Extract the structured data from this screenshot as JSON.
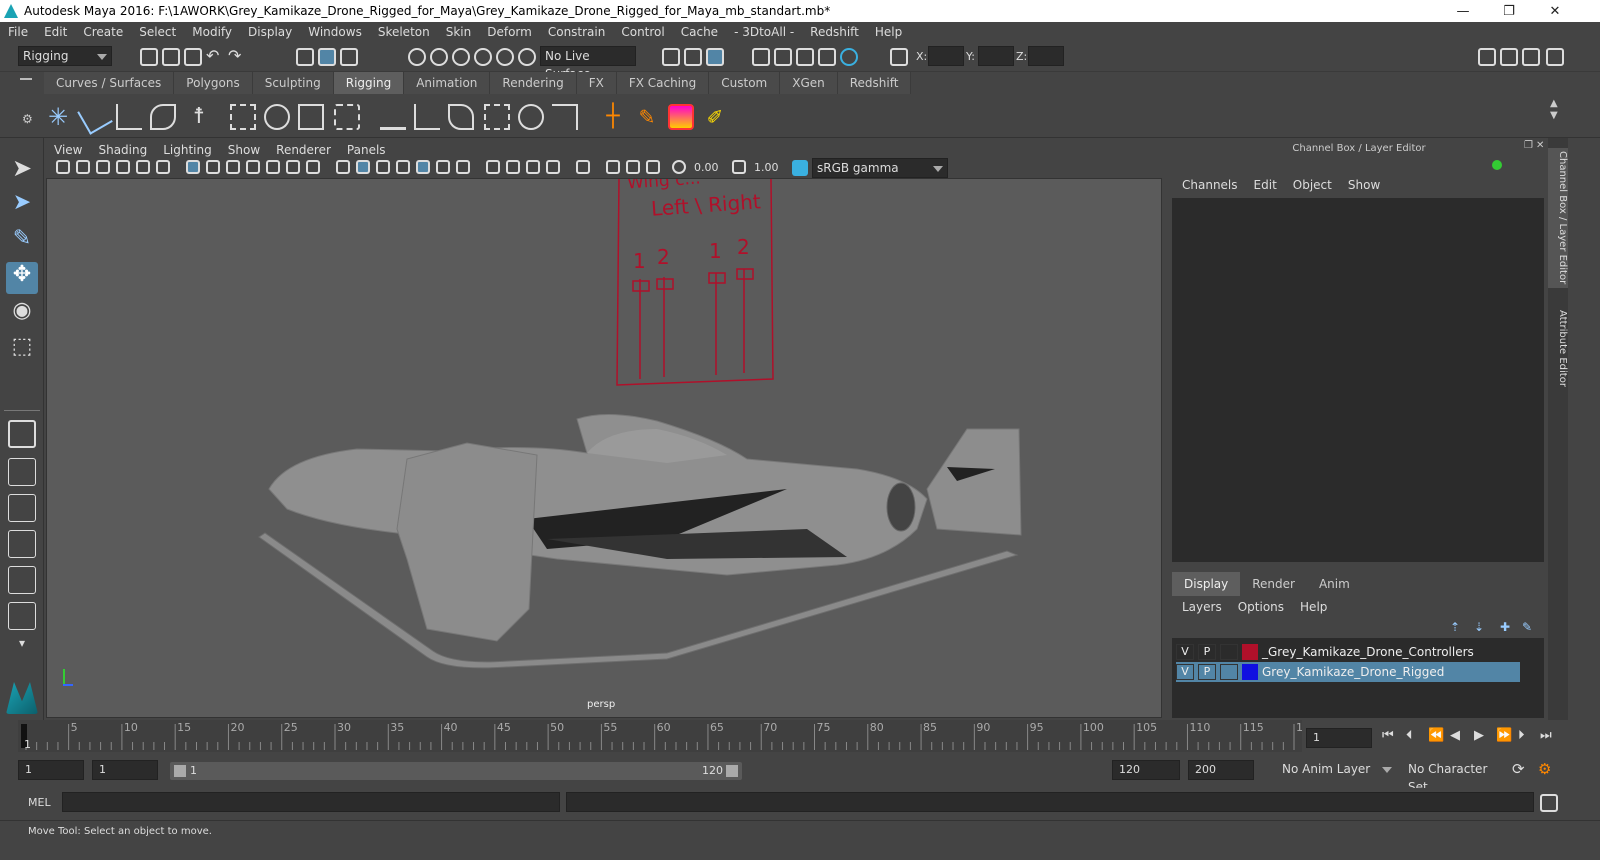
{
  "window": {
    "title": "Autodesk Maya 2016: F:\\1AWORK\\Grey_Kamikaze_Drone_Rigged_for_Maya\\Grey_Kamikaze_Drone_Rigged_for_Maya_mb_standart.mb*",
    "minimize": "—",
    "restore": "❐",
    "close": "✕"
  },
  "menu": [
    "File",
    "Edit",
    "Create",
    "Select",
    "Modify",
    "Display",
    "Windows",
    "Skeleton",
    "Skin",
    "Deform",
    "Constrain",
    "Control",
    "Cache",
    "- 3DtoAll -",
    "Redshift",
    "Help"
  ],
  "statusline": {
    "menuset": "Rigging",
    "live_surface": "No Live Surface",
    "x_label": "X:",
    "y_label": "Y:",
    "z_label": "Z:"
  },
  "shelf_tabs": [
    {
      "label": "Curves / Surfaces",
      "active": false
    },
    {
      "label": "Polygons",
      "active": false
    },
    {
      "label": "Sculpting",
      "active": false
    },
    {
      "label": "Rigging",
      "active": true
    },
    {
      "label": "Animation",
      "active": false
    },
    {
      "label": "Rendering",
      "active": false
    },
    {
      "label": "FX",
      "active": false
    },
    {
      "label": "FX Caching",
      "active": false
    },
    {
      "label": "Custom",
      "active": false
    },
    {
      "label": "XGen",
      "active": false
    },
    {
      "label": "Redshift",
      "active": false
    }
  ],
  "viewport": {
    "menu": [
      "View",
      "Shading",
      "Lighting",
      "Show",
      "Renderer",
      "Panels"
    ],
    "exposure": "0.00",
    "gamma": "1.00",
    "color_space": "sRGB gamma",
    "camera_label": "persp",
    "rig_panel": {
      "title": "Wing c...",
      "subtitle": "Left \\ Right",
      "numbers": [
        "1",
        "2",
        "1",
        "2"
      ]
    }
  },
  "channel_box": {
    "header": "Channel Box / Layer Editor",
    "menu": [
      "Channels",
      "Edit",
      "Object",
      "Show"
    ]
  },
  "layer_editor": {
    "tabs": [
      {
        "label": "Display",
        "active": true
      },
      {
        "label": "Render",
        "active": false
      },
      {
        "label": "Anim",
        "active": false
      }
    ],
    "menu": [
      "Layers",
      "Options",
      "Help"
    ],
    "layers": [
      {
        "v": "V",
        "p": "P",
        "color": "#b0102a",
        "name": "_Grey_Kamikaze_Drone_Controllers",
        "selected": false
      },
      {
        "v": "V",
        "p": "P",
        "color": "#1010e0",
        "name": "Grey_Kamikaze_Drone_Rigged",
        "selected": true
      }
    ]
  },
  "side_tabs": [
    "Channel Box / Layer Editor",
    "Attribute Editor"
  ],
  "timeline": {
    "ticks": [
      "5",
      "10",
      "15",
      "20",
      "25",
      "30",
      "35",
      "40",
      "45",
      "50",
      "55",
      "60",
      "65",
      "70",
      "75",
      "80",
      "85",
      "90",
      "95",
      "100",
      "105",
      "110",
      "115",
      "120"
    ],
    "current_frame_marker": "1",
    "current_frame_field": "1"
  },
  "range": {
    "start": "1",
    "playback_start": "1",
    "slider_start": "1",
    "slider_end": "120",
    "playback_end": "120",
    "end": "200",
    "anim_layer": "No Anim Layer",
    "character_set": "No Character Set"
  },
  "command_line": {
    "label": "MEL"
  },
  "help_line": "Move Tool: Select an object to move.",
  "colors": {
    "ui_bg": "#444444",
    "viewport_bg": "#5b5b5b",
    "accent_blue": "#5285a6",
    "rig_red": "#b0102a"
  }
}
